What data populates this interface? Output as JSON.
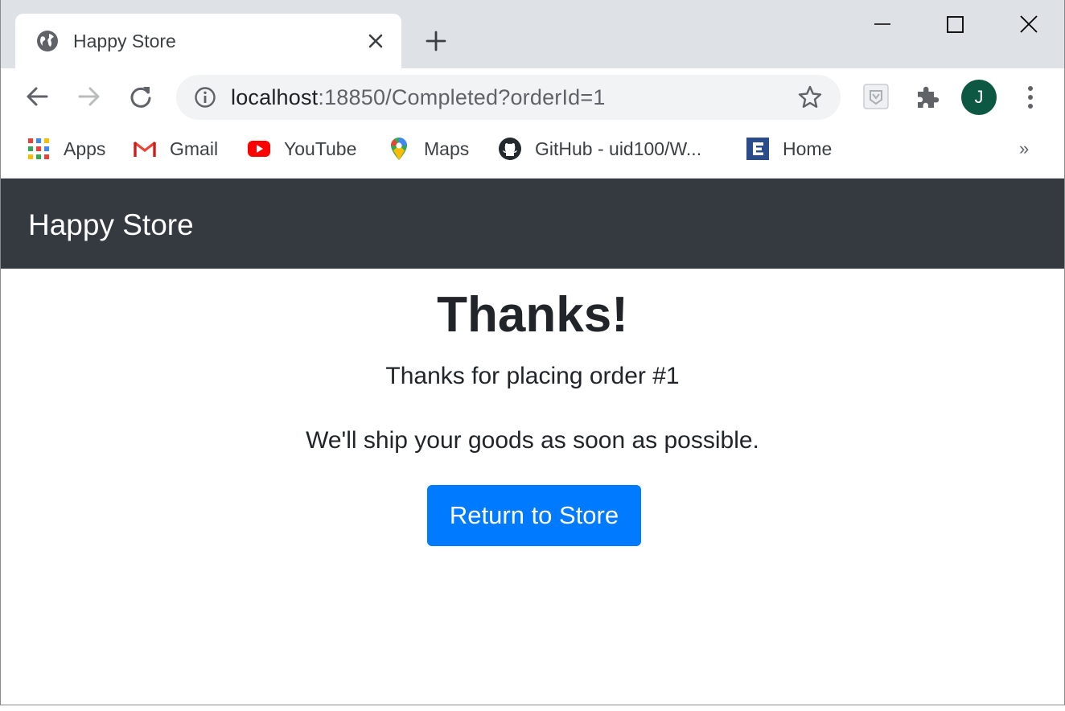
{
  "browser": {
    "tab": {
      "title": "Happy Store",
      "close_icon": "close-icon",
      "favicon": "globe-icon"
    },
    "address_bar": {
      "host": "localhost",
      "rest": ":18850/Completed?orderId=1"
    },
    "profile_initial": "J",
    "bookmarks": [
      {
        "label": "Apps",
        "icon": "apps-grid-icon"
      },
      {
        "label": "Gmail",
        "icon": "gmail-icon"
      },
      {
        "label": "YouTube",
        "icon": "youtube-icon"
      },
      {
        "label": "Maps",
        "icon": "maps-pin-icon"
      },
      {
        "label": "GitHub - uid100/W...",
        "icon": "github-icon"
      },
      {
        "label": "Home",
        "icon": "home-e-icon"
      }
    ],
    "bookmarks_overflow": "»",
    "colors": {
      "titlebar": "#dee1e6",
      "omnibox": "#f1f3f4",
      "avatar": "#0d5842"
    }
  },
  "site": {
    "brand": "Happy Store",
    "heading": "Thanks!",
    "order_message": "Thanks for placing order #1",
    "ship_message": "We'll ship your goods as soon as possible.",
    "return_button": "Return to Store",
    "colors": {
      "navbar": "#343a40",
      "primary": "#007bff",
      "text": "#212529"
    }
  }
}
